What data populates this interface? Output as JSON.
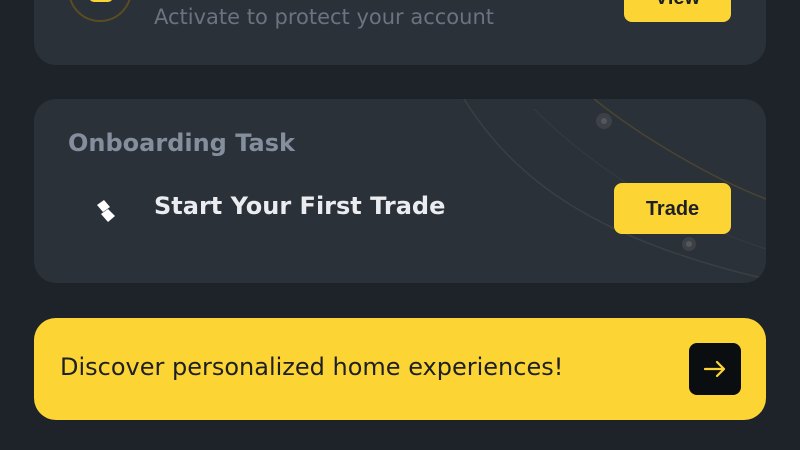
{
  "security_card": {
    "subtitle": "Activate to protect your account",
    "view_label": "View",
    "icon": "shield-star-icon"
  },
  "onboarding_card": {
    "title": "Onboarding Task",
    "task_label": "Start Your First Trade",
    "task_icon": "trade-diamond-icon",
    "trade_label": "Trade"
  },
  "promo_banner": {
    "text": "Discover personalized home experiences!",
    "arrow_icon": "arrow-right-icon"
  },
  "colors": {
    "background": "#1e2329",
    "card": "#2b3139",
    "accent": "#fcd535",
    "muted_text": "#848e9c",
    "primary_text": "#eaecef"
  }
}
